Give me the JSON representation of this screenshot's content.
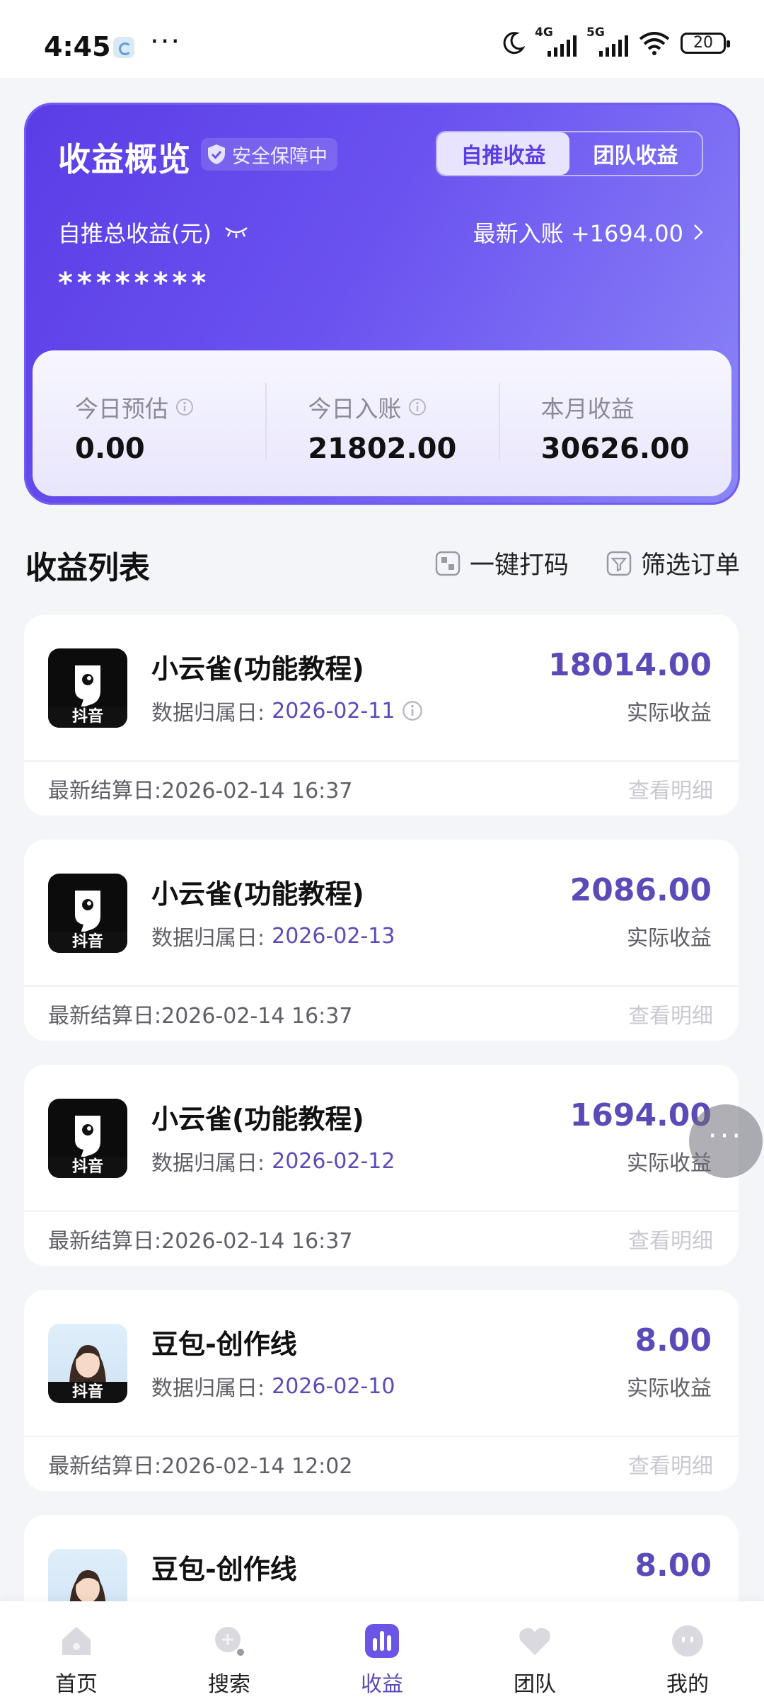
{
  "status_bar": {
    "time": "4:45",
    "dots": "···",
    "net1": "4G",
    "net2": "5G",
    "battery": "20"
  },
  "overview": {
    "title": "收益概览",
    "badge": "安全保障中",
    "tabs": [
      "自推收益",
      "团队收益"
    ],
    "active_tab": "自推收益",
    "total_label": "自推总收益(元)",
    "latest_label": "最新入账 +1694.00",
    "masked_value": "********",
    "stats": [
      {
        "label": "今日预估",
        "value": "0.00"
      },
      {
        "label": "今日入账",
        "value": "21802.00"
      },
      {
        "label": "本月收益",
        "value": "30626.00"
      }
    ]
  },
  "list": {
    "title": "收益列表",
    "action_code": "一键打码",
    "action_filter": "筛选订单",
    "items": [
      {
        "title": "小云雀(功能教程)",
        "date_label": "数据归属日:",
        "date": "2026-02-11",
        "amount": "18014.00",
        "sub": "实际收益",
        "settle": "最新结算日:2026-02-14 16:37",
        "detail": "查看明细",
        "platform": "抖音",
        "logo": "dark"
      },
      {
        "title": "小云雀(功能教程)",
        "date_label": "数据归属日:",
        "date": "2026-02-13",
        "amount": "2086.00",
        "sub": "实际收益",
        "settle": "最新结算日:2026-02-14 16:37",
        "detail": "查看明细",
        "platform": "抖音",
        "logo": "dark"
      },
      {
        "title": "小云雀(功能教程)",
        "date_label": "数据归属日:",
        "date": "2026-02-12",
        "amount": "1694.00",
        "sub": "实际收益",
        "settle": "最新结算日:2026-02-14 16:37",
        "detail": "查看明细",
        "platform": "抖音",
        "logo": "dark"
      },
      {
        "title": "豆包-创作线",
        "date_label": "数据归属日:",
        "date": "2026-02-10",
        "amount": "8.00",
        "sub": "实际收益",
        "settle": "最新结算日:2026-02-14 12:02",
        "detail": "查看明细",
        "platform": "抖音",
        "logo": "avatar"
      },
      {
        "title": "豆包-创作线",
        "amount": "8.00",
        "logo": "avatar"
      }
    ]
  },
  "fab": "···",
  "nav": {
    "items": [
      {
        "label": "首页",
        "icon": "home-icon"
      },
      {
        "label": "搜索",
        "icon": "search-icon"
      },
      {
        "label": "收益",
        "icon": "earnings-chart-icon"
      },
      {
        "label": "团队",
        "icon": "team-heart-icon"
      },
      {
        "label": "我的",
        "icon": "profile-face-icon"
      }
    ],
    "active": "收益",
    "accent": "#5b4bb8"
  }
}
